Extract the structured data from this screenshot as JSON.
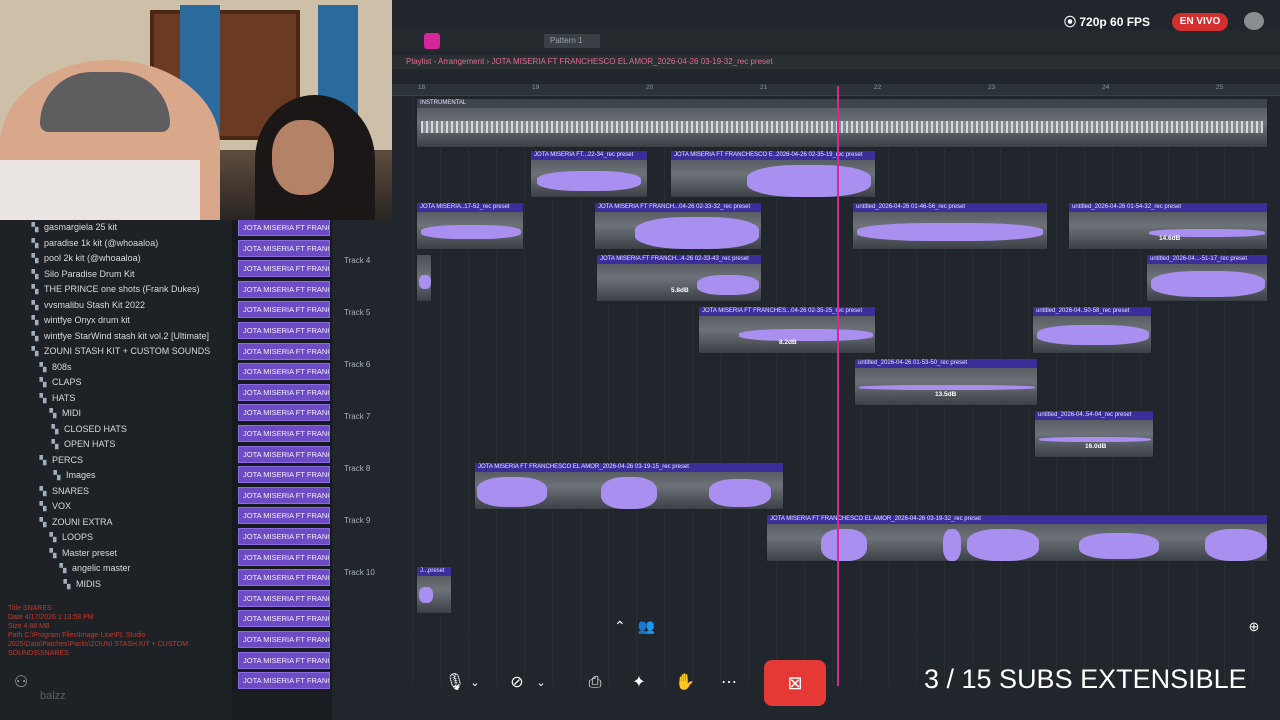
{
  "stream": {
    "quality": "720p 60 FPS",
    "live_label": "EN VIVO",
    "subs_counter": "3 / 15 SUBS EXTENSIBLE"
  },
  "playlist": {
    "title": "Playlist - Arrangement › JOTA MISERIA FT FRANCHESCO EL AMOR_2026-04-26 03-19-32_rec preset",
    "pattern": "Pattern 1",
    "ruler": [
      "18",
      "19",
      "20",
      "21",
      "22",
      "23",
      "24",
      "25"
    ],
    "track_labels": [
      "Track 4",
      "Track 5",
      "Track 6",
      "Track 7",
      "Track 8",
      "Track 9",
      "Track 10"
    ],
    "instrumental": "INSTRUMENTAL",
    "clips": {
      "c1": "JOTA MISERIA FT...22-34_rec preset",
      "c2": "JOTA MISERIA FT FRANCHESCO E..2026-04-26 02-35-19_rec preset",
      "c3": "JOTA MISERIA..17-52_rec preset",
      "c4": "JOTA MISERIA FT FRANCH...04-26 02-33-32_rec preset",
      "c5": "untitled_2026-04-26 01-46-56_rec preset",
      "c6": "untitled_2026-04-26 01-54-32_rec preset",
      "c7": "JOTA MISERIA FT FRANCH...4-26 02-33-43_rec preset",
      "c8": "untitled_2026-04...-51-17_rec preset",
      "c9": "JOTA MISERIA FT FRANCHES...04-26 02-35-25_rec preset",
      "c10": "untitled_2026-04..50-58_rec preset",
      "c11": "untitled_2026-04-26 01-53-50_rec preset",
      "c12": "untitled_2026-04..54-04_rec preset",
      "c13": "JOTA MISERIA FT FRANCHESCO EL AMOR_2026-04-26 03-19-15_rec preset",
      "c14": "JOTA MISERIA FT FRANCHESCO EL AMOR_2026-04-26 03-19-32_rec preset",
      "c15": "J...preset"
    },
    "db": {
      "d1": "14.6dB",
      "d2": "5.8dB",
      "d3": "8.2dB",
      "d4": "13.5dB",
      "d5": "16.0dB"
    }
  },
  "browser": {
    "items": [
      {
        "label": "gasmargiela 25 kit",
        "icon": "folder-icon"
      },
      {
        "label": "paradise 1k kit (@whoaaloa)",
        "icon": "folder-icon"
      },
      {
        "label": "pool 2k kit (@whoaaloa)",
        "icon": "folder-icon"
      },
      {
        "label": "Silo Paradise Drum Kit",
        "icon": "folder-icon"
      },
      {
        "label": "THE PRINCE one shots (Frank Dukes)",
        "icon": "folder-icon"
      },
      {
        "label": "vvsmalibu Stash Kit 2022",
        "icon": "folder-icon"
      },
      {
        "label": "wintfye Onyx drum kit",
        "icon": "folder-icon"
      },
      {
        "label": "wintfye StarWind stash kit vol.2 [Ultimate]",
        "icon": "folder-icon"
      },
      {
        "label": "ZOUNI STASH KIT + CUSTOM SOUNDS",
        "icon": "folder-icon"
      },
      {
        "label": "808s",
        "icon": "folder-icon"
      },
      {
        "label": "CLAPS",
        "icon": "folder-icon"
      },
      {
        "label": "HATS",
        "icon": "folder-icon"
      },
      {
        "label": "MIDI",
        "icon": "folder-icon"
      },
      {
        "label": "CLOSED HATS",
        "icon": "folder-icon"
      },
      {
        "label": "OPEN HATS",
        "icon": "folder-icon"
      },
      {
        "label": "PERCS",
        "icon": "folder-icon"
      },
      {
        "label": "Images",
        "icon": "folder-icon"
      },
      {
        "label": "SNARES",
        "icon": "folder-icon"
      },
      {
        "label": "VOX",
        "icon": "folder-icon"
      },
      {
        "label": "ZOUNI EXTRA",
        "icon": "folder-icon"
      },
      {
        "label": "LOOPS",
        "icon": "folder-icon"
      },
      {
        "label": "Master preset",
        "icon": "folder-icon"
      },
      {
        "label": "angelic master",
        "icon": "folder-icon"
      },
      {
        "label": "MIDIS",
        "icon": "folder-icon"
      }
    ],
    "info": {
      "title": "Title   SNARES",
      "date": "Date   4/17/2026 1:13:58 PM",
      "size": "Size   4.88 MB",
      "path": "Path   C:\\Program Files\\Image-Line\\FL Studio 2025\\Data\\Patches\\Packs\\ZOUNI STASH KIT + CUSTOM SOUNDS\\SNARES"
    }
  },
  "channel_label": "JOTA MISERIA FT FRANCH...",
  "watermark": "balzz"
}
